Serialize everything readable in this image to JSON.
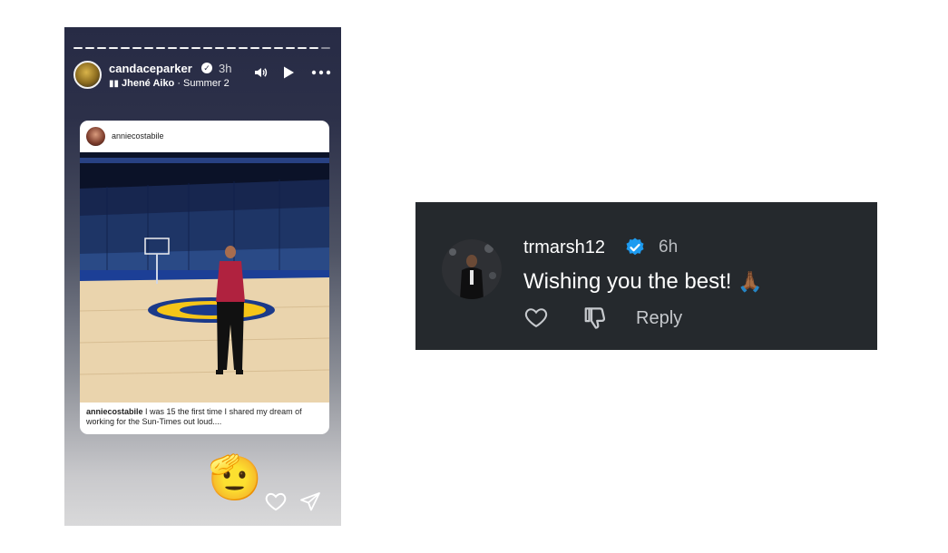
{
  "story": {
    "username": "candaceparker",
    "time": "3h",
    "music": {
      "artist": "Jhené Aiko",
      "song": " · Summer 2"
    },
    "controls": {
      "sound": "sound-icon",
      "play": "play-icon",
      "more": "more-icon"
    },
    "shared_post": {
      "username": "anniecostabile",
      "caption_user": "anniecostabile",
      "caption_text": " I was 15 the first time I shared my dream of working for the Sun-Times out loud...."
    },
    "sticker": "🫡",
    "actions": {
      "like": "heart-icon",
      "send": "send-icon"
    }
  },
  "comment": {
    "username": "trmarsh12",
    "time": "6h",
    "text": "Wishing you the best! ",
    "emoji": "🙏🏾",
    "reply_label": "Reply",
    "colors": {
      "background": "#25292d",
      "verified": "#1d9bf0"
    }
  }
}
